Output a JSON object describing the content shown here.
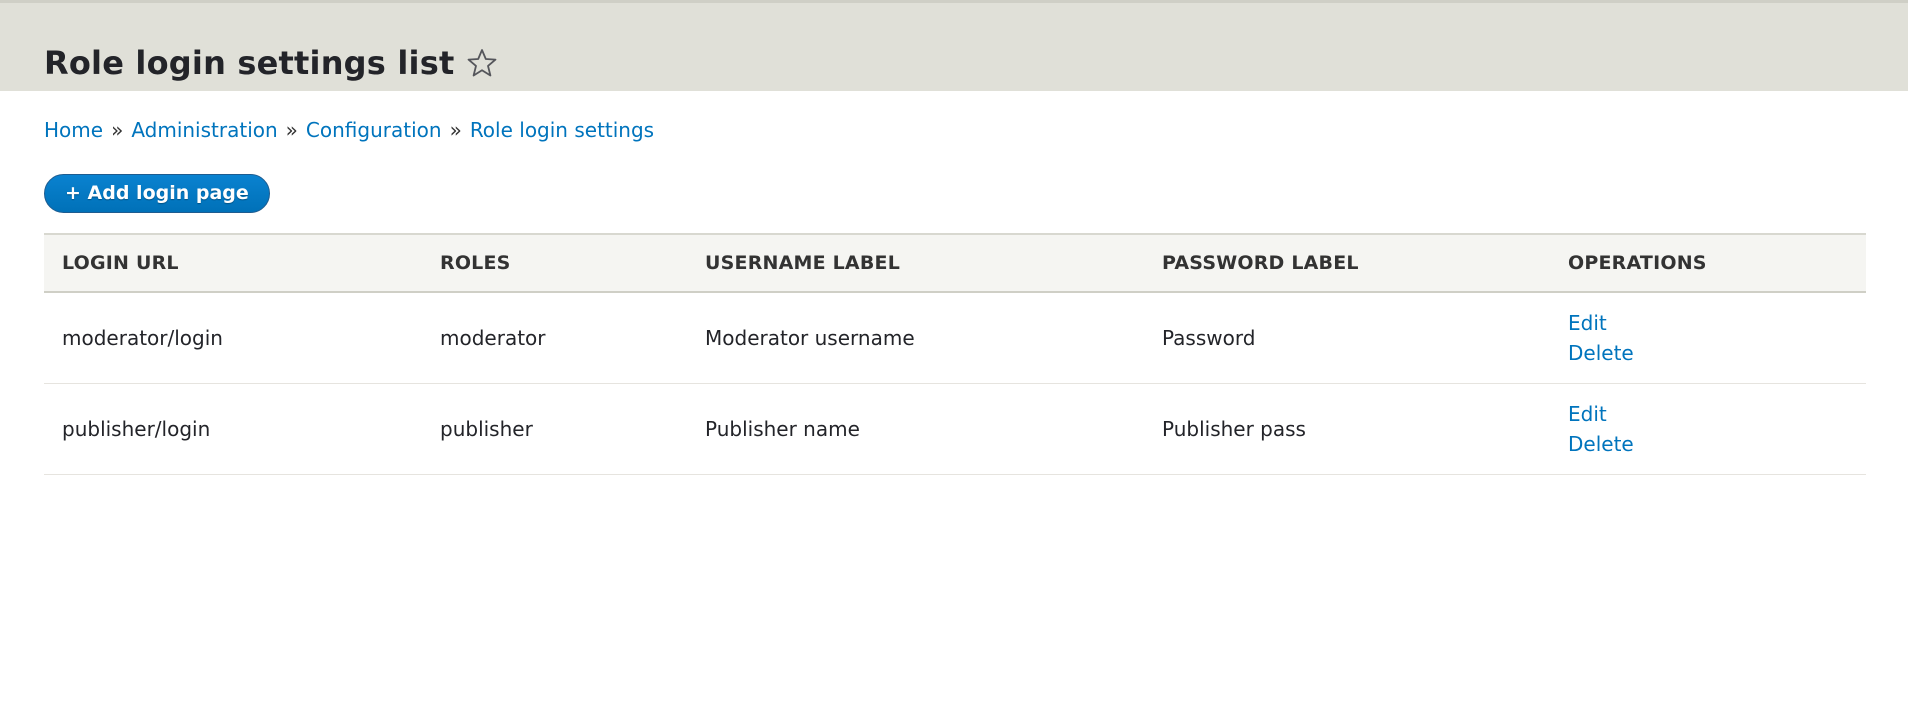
{
  "header": {
    "title": "Role login settings list",
    "star_icon": "star-outline-icon"
  },
  "breadcrumb": [
    {
      "label": "Home"
    },
    {
      "label": "Administration"
    },
    {
      "label": "Configuration"
    },
    {
      "label": "Role login settings"
    }
  ],
  "breadcrumb_separator": "»",
  "actions": {
    "add_label": "+ Add login page"
  },
  "table": {
    "columns": [
      "LOGIN URL",
      "ROLES",
      "USERNAME LABEL",
      "PASSWORD LABEL",
      "OPERATIONS"
    ],
    "rows": [
      {
        "login_url": "moderator/login",
        "roles": "moderator",
        "username_label": "Moderator username",
        "password_label": "Password",
        "edit": "Edit",
        "delete": "Delete"
      },
      {
        "login_url": "publisher/login",
        "roles": "publisher",
        "username_label": "Publisher name",
        "password_label": "Publisher pass",
        "edit": "Edit",
        "delete": "Delete"
      }
    ]
  },
  "colors": {
    "link": "#0074bd",
    "header_bg": "#e0e0d8",
    "button_bg": "#0071b8"
  }
}
